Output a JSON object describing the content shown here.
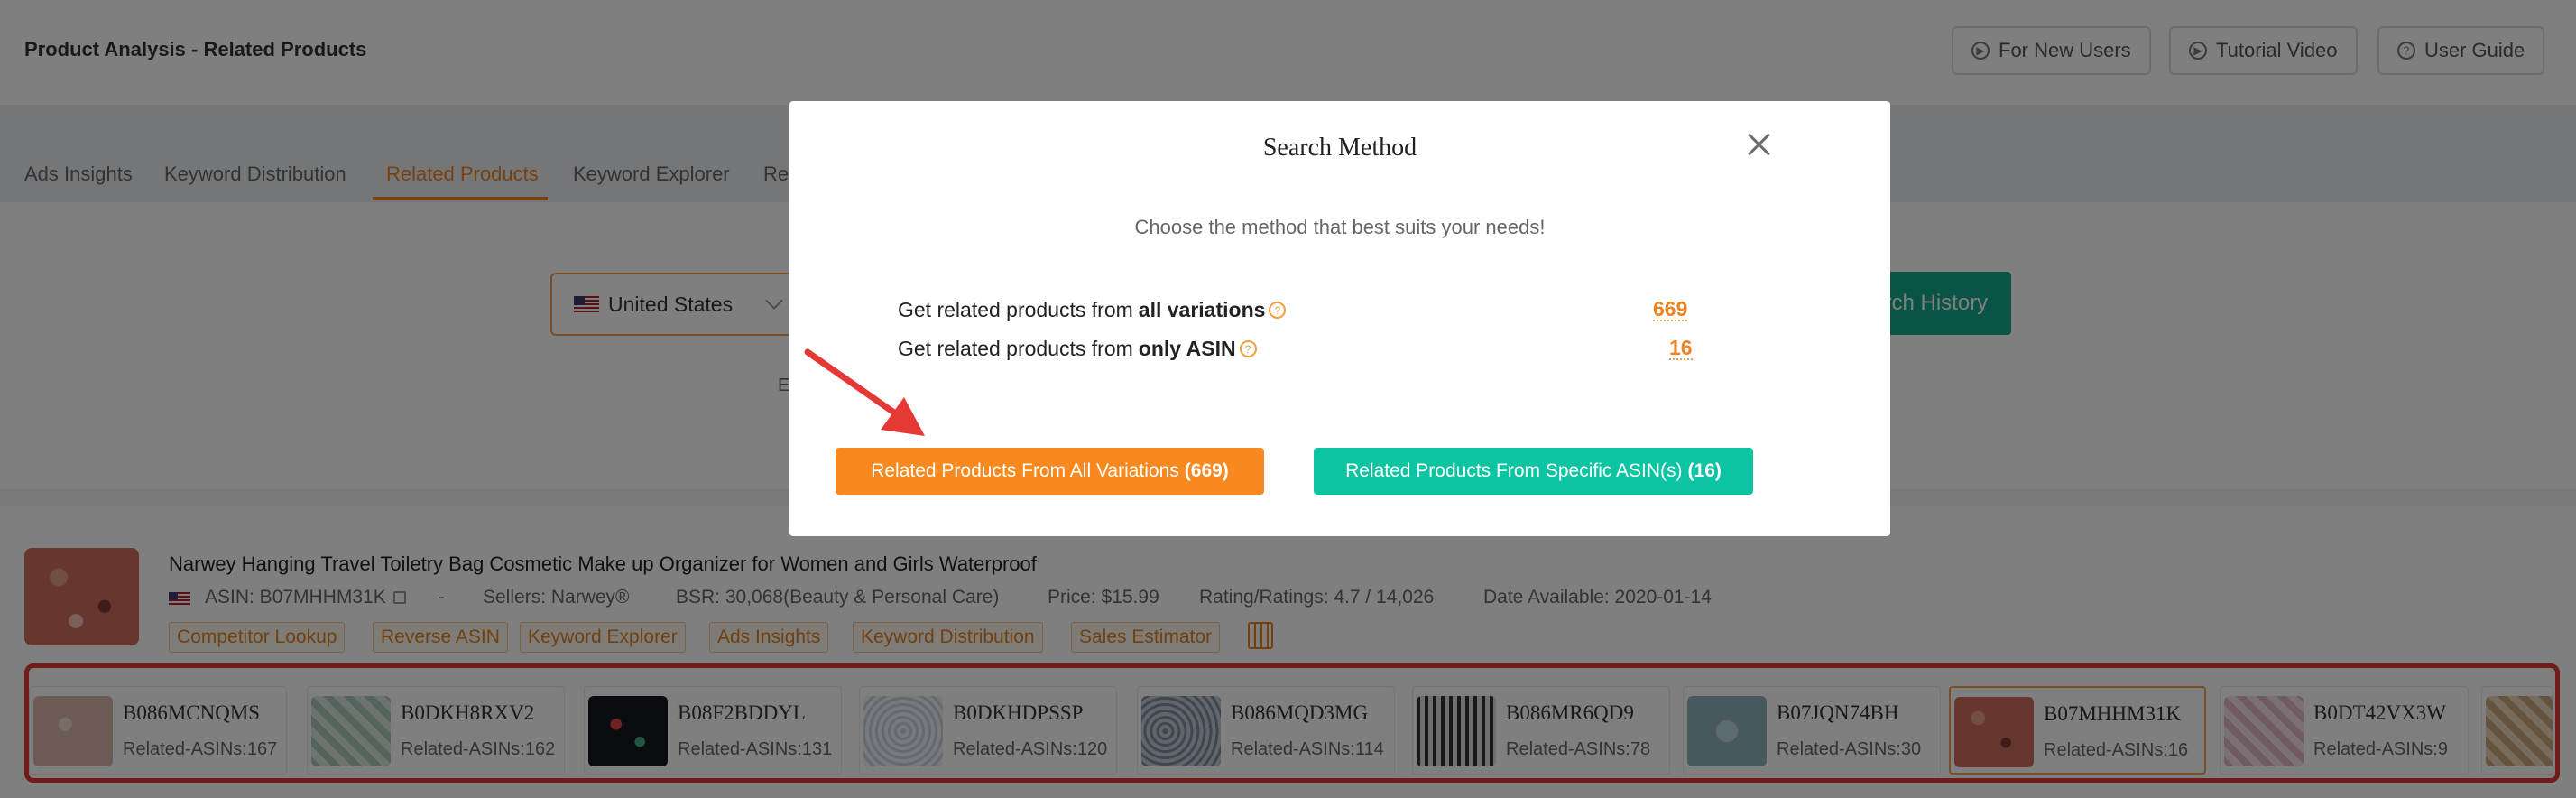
{
  "header": {
    "title": "Product Analysis - Related Products",
    "buttons": [
      "For New Users",
      "Tutorial Video",
      "User Guide"
    ]
  },
  "tabs": {
    "items": [
      "Ads Insights",
      "Keyword Distribution",
      "Related Products",
      "Keyword Explorer",
      "Re"
    ],
    "active": "Related Products"
  },
  "search": {
    "country": "United States",
    "history_label": "Search History",
    "fragment": "E"
  },
  "product": {
    "title": "Narwey Hanging Travel Toiletry Bag Cosmetic Make up Organizer for Women and Girls Waterproof",
    "asin": "ASIN: B07MHHM31K",
    "dash": "-",
    "sellers": "Sellers: Narwey®",
    "bsr": "BSR: 30,068(Beauty & Personal Care)",
    "price": "Price: $15.99",
    "rating": "Rating/Ratings: 4.7 / 14,026",
    "date": "Date Available: 2020-01-14",
    "tags": [
      "Competitor Lookup",
      "Reverse ASIN",
      "Keyword Explorer",
      "Ads Insights",
      "Keyword Distribution",
      "Sales Estimator"
    ]
  },
  "variations": [
    {
      "asin": "B086MCNQMS",
      "count": "Related-ASINs:167"
    },
    {
      "asin": "B0DKH8RXV2",
      "count": "Related-ASINs:162"
    },
    {
      "asin": "B08F2BDDYL",
      "count": "Related-ASINs:131"
    },
    {
      "asin": "B0DKHDPSSP",
      "count": "Related-ASINs:120"
    },
    {
      "asin": "B086MQD3MG",
      "count": "Related-ASINs:114"
    },
    {
      "asin": "B086MR6QD9",
      "count": "Related-ASINs:78"
    },
    {
      "asin": "B07JQN74BH",
      "count": "Related-ASINs:30"
    },
    {
      "asin": "B07MHHM31K",
      "count": "Related-ASINs:16"
    },
    {
      "asin": "B0DT42VX3W",
      "count": "Related-ASINs:9"
    }
  ],
  "modal": {
    "title": "Search Method",
    "subtitle": "Choose the method that best suits your needs!",
    "option_all": {
      "prefix": "Get related products from",
      "bold": "all variations",
      "value": "669"
    },
    "option_only": {
      "prefix": "Get related products from",
      "bold": "only ASIN",
      "value": "16"
    },
    "btn_all": {
      "label": "Related Products From All Variations",
      "count": "(669)"
    },
    "btn_specific": {
      "label": "Related Products From Specific ASIN(s)",
      "count": "(16)"
    }
  },
  "colors": {
    "accent_orange": "#f7891e",
    "accent_teal": "#0cc4a2",
    "history_green": "#12a989",
    "highlight_red": "#e53935"
  }
}
